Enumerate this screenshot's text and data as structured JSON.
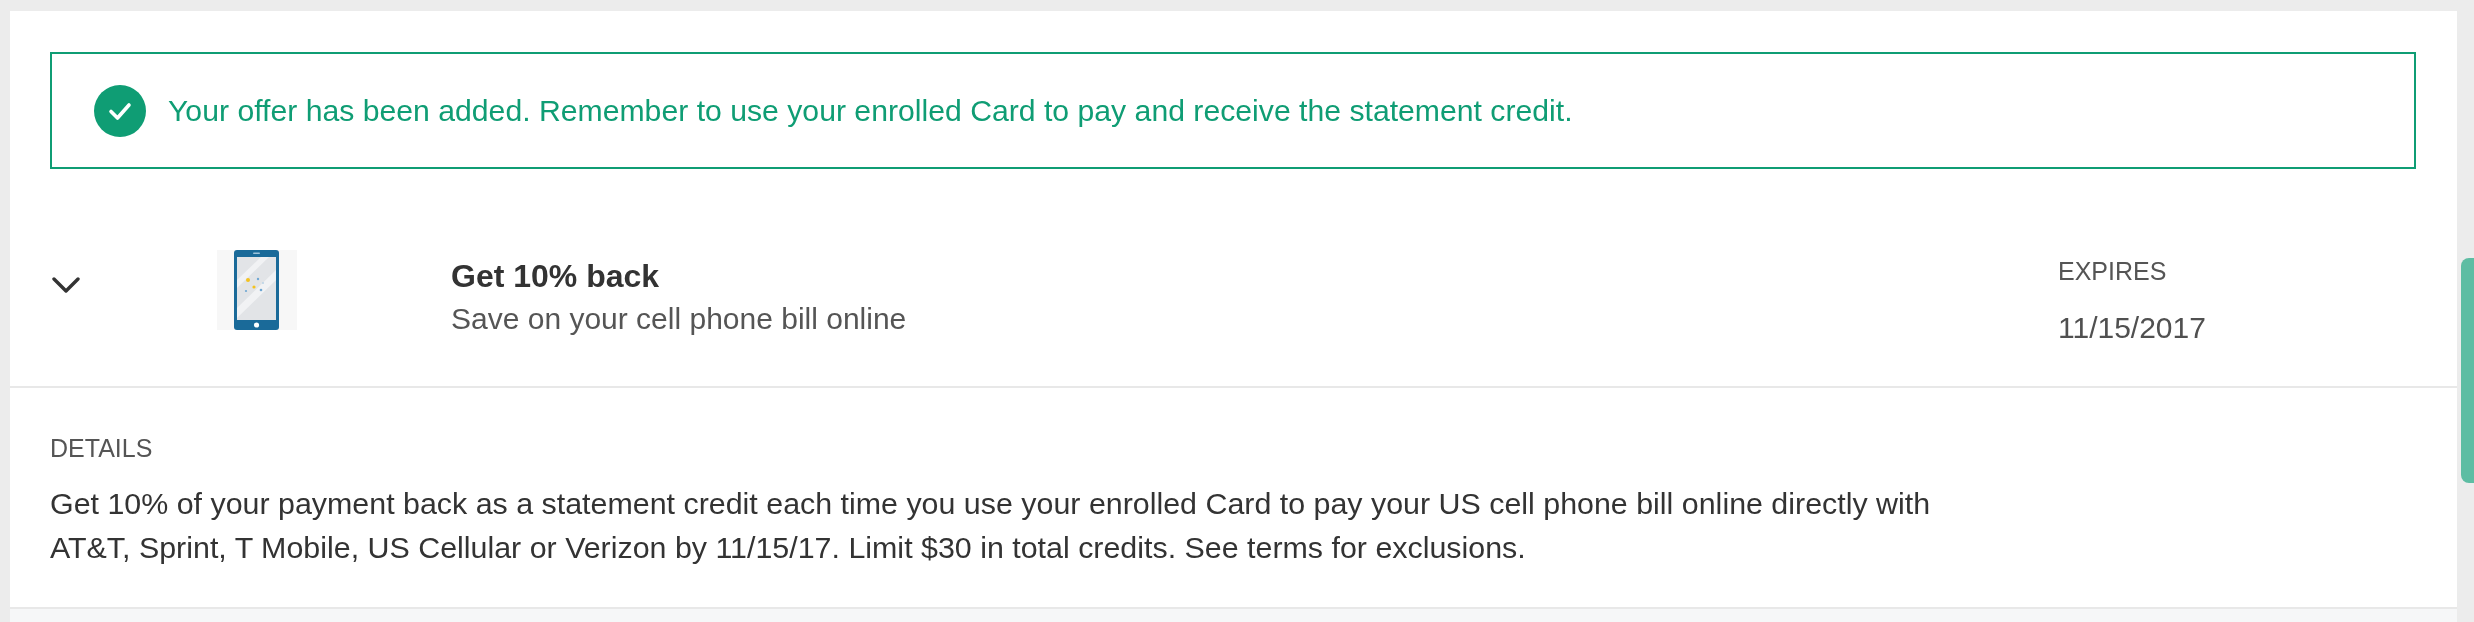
{
  "banner": {
    "kind": "success",
    "message": "Your offer has been added. Remember to use your enrolled Card to pay and receive the statement credit."
  },
  "offer": {
    "expanded": true,
    "title": "Get 10% back",
    "subtitle": "Save on your cell phone bill online",
    "expires_label": "EXPIRES",
    "expires_date": "11/15/2017"
  },
  "details": {
    "heading": "DETAILS",
    "text": "Get 10% of your payment back as a statement credit each time you use your enrolled Card to pay your US cell phone bill online directly with AT&T, Sprint, T Mobile, US Cellular or Verizon by 11/15/17. Limit $30 in total credits. See terms for exclusions."
  },
  "side_tab": {
    "shown": true
  }
}
